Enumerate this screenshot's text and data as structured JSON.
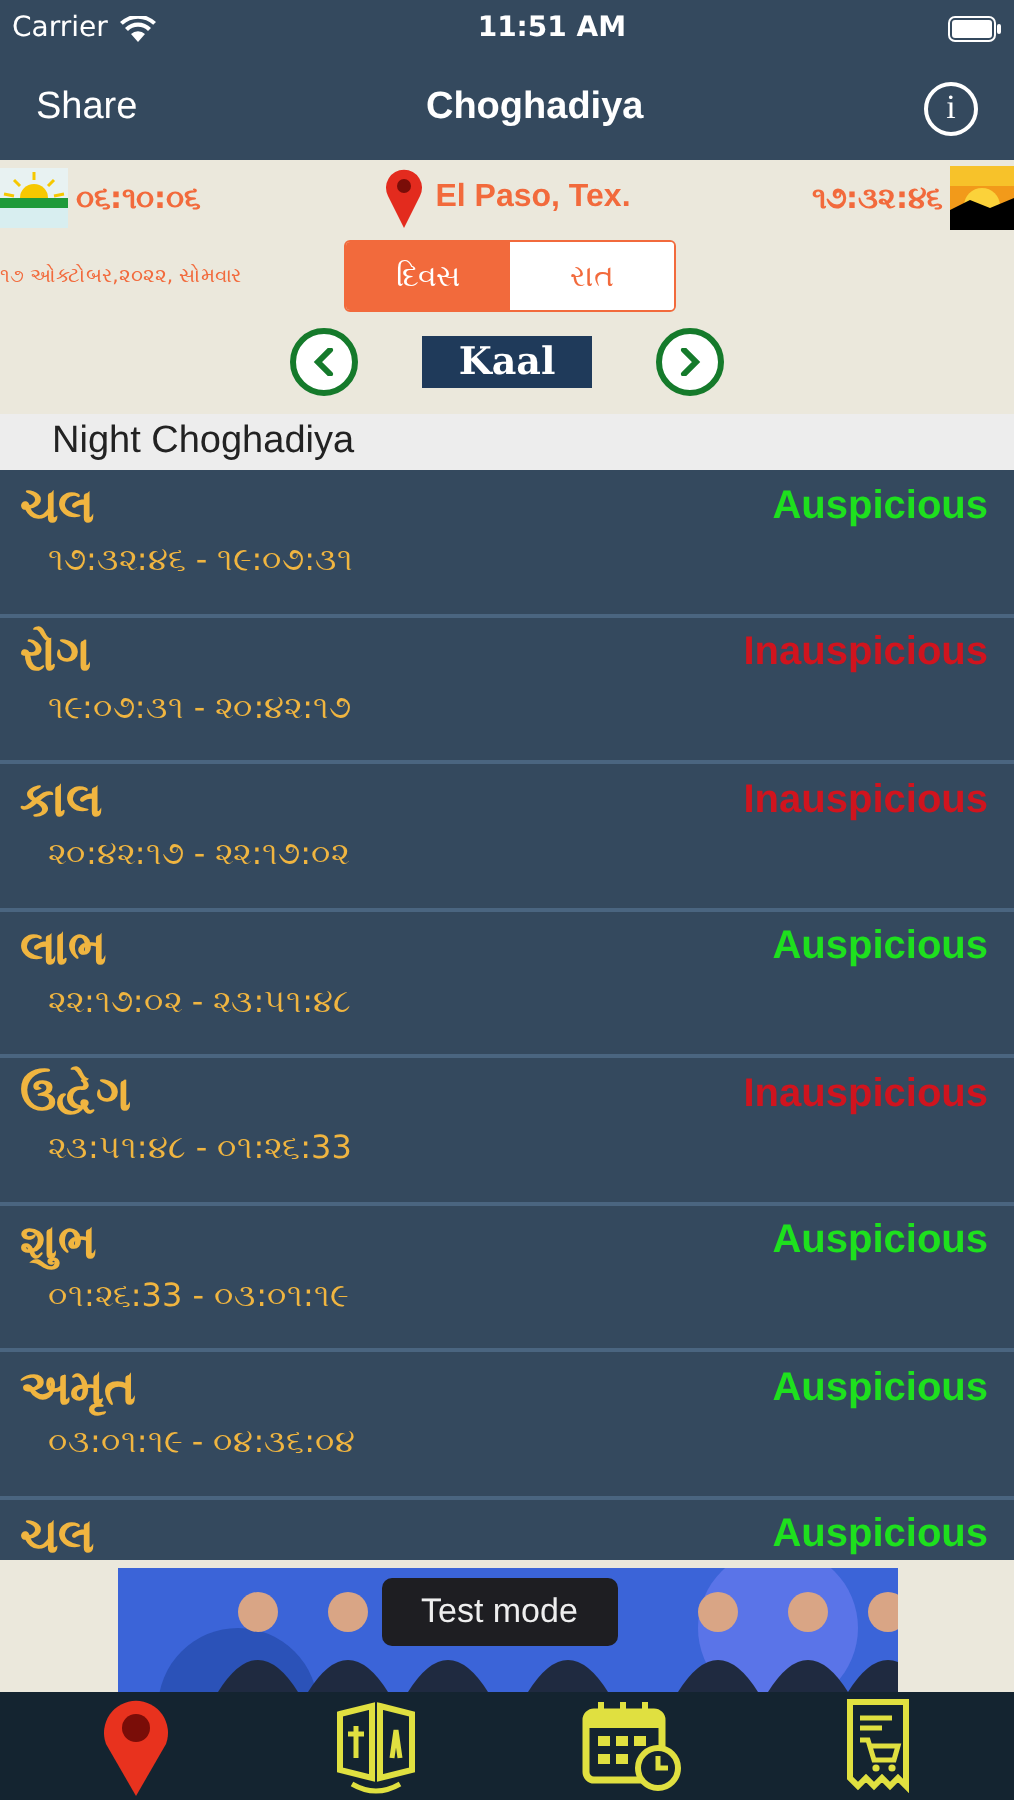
{
  "status_bar": {
    "carrier": "Carrier",
    "time": "11:51 AM"
  },
  "nav": {
    "left": "Share",
    "title": "Choghadiya",
    "info": "i"
  },
  "header": {
    "sunrise": "૦૬:૧૦:૦૬",
    "location": "El Paso, Tex.",
    "sunset": "૧૭:૩૨:૪૬",
    "date": "૧૭ ઓક્ટોબર,૨૦૨૨, સોમવાર",
    "segments": [
      {
        "label": "દિવસ",
        "selected": true
      },
      {
        "label": "રાત",
        "selected": false
      }
    ],
    "period": "Kaal"
  },
  "section_title": "Night Choghadiya",
  "rows": [
    {
      "name": "ચલ",
      "time": "૧૭:૩૨:૪૬ - ૧૯:૦૭:૩૧",
      "status": "Auspicious",
      "kind": "good"
    },
    {
      "name": "રોગ",
      "time": "૧૯:૦૭:૩૧ - ૨૦:૪૨:૧૭",
      "status": "Inauspicious",
      "kind": "bad"
    },
    {
      "name": "કાલ",
      "time": "૨૦:૪૨:૧૭ - ૨૨:૧૭:૦૨",
      "status": "Inauspicious",
      "kind": "bad"
    },
    {
      "name": "લાભ",
      "time": "૨૨:૧૭:૦૨ - ૨૩:૫૧:૪૮",
      "status": "Auspicious",
      "kind": "good"
    },
    {
      "name": "ઉદ્વેગ",
      "time": "૨૩:૫૧:૪૮ - ૦૧:૨૬:33",
      "status": "Inauspicious",
      "kind": "bad"
    },
    {
      "name": "શુભ",
      "time": "૦૧:૨૬:33 - ૦૩:૦૧:૧૯",
      "status": "Auspicious",
      "kind": "good"
    },
    {
      "name": "અમૃત",
      "time": "૦૩:૦૧:૧૯ - ૦૪:૩૬:૦૪",
      "status": "Auspicious",
      "kind": "good"
    },
    {
      "name": "ચલ",
      "status": "Auspicious",
      "kind": "good"
    }
  ],
  "ad": {
    "kind": "picture",
    "badge": "Test mode"
  },
  "tab_bar": [
    {
      "kind": "pin",
      "selected": true
    },
    {
      "kind": "translate",
      "selected": false
    },
    {
      "kind": "calendar",
      "selected": false
    },
    {
      "kind": "cart",
      "selected": false
    }
  ]
}
